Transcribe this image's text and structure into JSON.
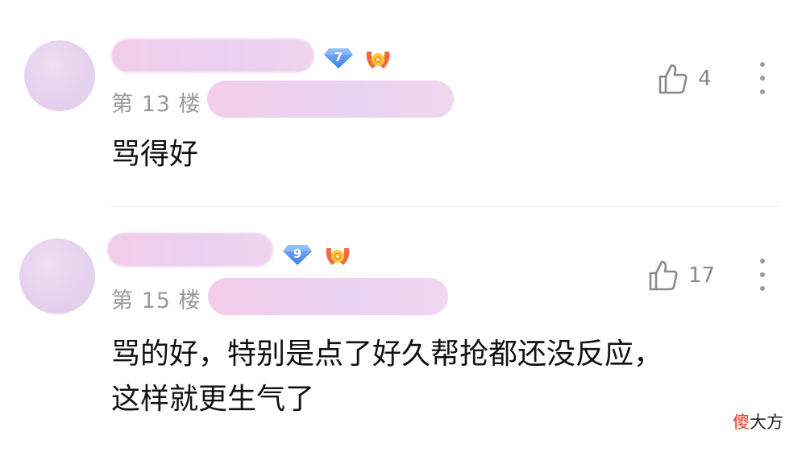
{
  "comments": [
    {
      "floor": "第 13 楼",
      "level": "7",
      "text": "骂得好",
      "likes": "4",
      "badge_color": "#4a8ef0"
    },
    {
      "floor": "第 15 楼",
      "level": "9",
      "text": "骂的好，特别是点了好久帮抢都还没反应，这样就更生气了",
      "likes": "17",
      "badge_color": "#4a8ef0"
    }
  ],
  "icons": {
    "like": "thumbs-up-outline-icon",
    "more": "vertical-dots-icon",
    "level_badge": "diamond-level-icon",
    "medal": "orange-medal-icon"
  },
  "watermark": {
    "highlight": "傻",
    "rest": "大方",
    "highlight_color": "#e0341f"
  }
}
